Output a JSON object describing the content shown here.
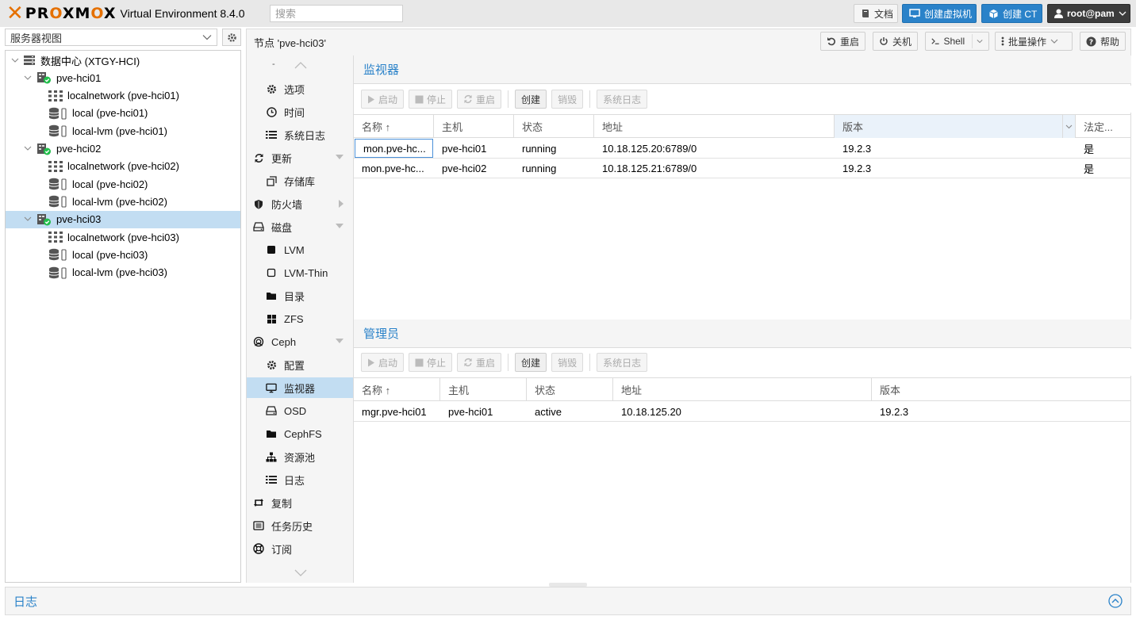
{
  "header": {
    "product_name": "PROXMOX",
    "version": "Virtual Environment 8.4.0",
    "search_placeholder": "搜索",
    "docs_label": "文档",
    "create_vm_label": "创建虚拟机",
    "create_ct_label": "创建 CT",
    "user_label": "root@pam"
  },
  "left": {
    "view_select": "服务器视图",
    "tree": [
      {
        "label": "数据中心 (XTGY-HCI)",
        "type": "datacenter",
        "level": 0
      },
      {
        "label": "pve-hci01",
        "type": "node",
        "level": 1
      },
      {
        "label": "localnetwork (pve-hci01)",
        "type": "network",
        "level": 2
      },
      {
        "label": "local (pve-hci01)",
        "type": "storage",
        "level": 2
      },
      {
        "label": "local-lvm (pve-hci01)",
        "type": "storage",
        "level": 2
      },
      {
        "label": "pve-hci02",
        "type": "node",
        "level": 1
      },
      {
        "label": "localnetwork (pve-hci02)",
        "type": "network",
        "level": 2
      },
      {
        "label": "local (pve-hci02)",
        "type": "storage",
        "level": 2
      },
      {
        "label": "local-lvm (pve-hci02)",
        "type": "storage",
        "level": 2
      },
      {
        "label": "pve-hci03",
        "type": "node",
        "level": 1,
        "selected": true
      },
      {
        "label": "localnetwork (pve-hci03)",
        "type": "network",
        "level": 2
      },
      {
        "label": "local (pve-hci03)",
        "type": "storage",
        "level": 2
      },
      {
        "label": "local-lvm (pve-hci03)",
        "type": "storage",
        "level": 2
      }
    ]
  },
  "node": {
    "title": "节点 'pve-hci03'",
    "reboot_label": "重启",
    "shutdown_label": "关机",
    "shell_label": "Shell",
    "bulk_label": "批量操作",
    "help_label": "帮助"
  },
  "menu": [
    {
      "label": "选项",
      "icon": "gear-icon",
      "indent": true
    },
    {
      "label": "时间",
      "icon": "clock-icon",
      "indent": true
    },
    {
      "label": "系统日志",
      "icon": "list-icon",
      "indent": true
    },
    {
      "label": "更新",
      "icon": "refresh-icon",
      "indent": false,
      "expand": "down"
    },
    {
      "label": "存储库",
      "icon": "repo-icon",
      "indent": true
    },
    {
      "label": "防火墙",
      "icon": "shield-icon",
      "indent": false,
      "expand": "right"
    },
    {
      "label": "磁盘",
      "icon": "disk-icon",
      "indent": false,
      "expand": "down"
    },
    {
      "label": "LVM",
      "icon": "square-icon",
      "indent": true
    },
    {
      "label": "LVM-Thin",
      "icon": "square-outline-icon",
      "indent": true
    },
    {
      "label": "目录",
      "icon": "folder-icon",
      "indent": true
    },
    {
      "label": "ZFS",
      "icon": "grid-icon",
      "indent": true
    },
    {
      "label": "Ceph",
      "icon": "ceph-icon",
      "indent": false,
      "expand": "down"
    },
    {
      "label": "配置",
      "icon": "gear-icon",
      "indent": true
    },
    {
      "label": "监视器",
      "icon": "monitor-icon",
      "indent": true,
      "selected": true
    },
    {
      "label": "OSD",
      "icon": "disk-icon",
      "indent": true
    },
    {
      "label": "CephFS",
      "icon": "folder-icon",
      "indent": true
    },
    {
      "label": "资源池",
      "icon": "sitemap-icon",
      "indent": true
    },
    {
      "label": "日志",
      "icon": "list-icon",
      "indent": true
    },
    {
      "label": "复制",
      "icon": "retweet-icon",
      "indent": false
    },
    {
      "label": "任务历史",
      "icon": "history-icon",
      "indent": false
    },
    {
      "label": "订阅",
      "icon": "lifebuoy-icon",
      "indent": false
    }
  ],
  "monitor": {
    "title": "监视器",
    "toolbar": {
      "start": "启动",
      "stop": "停止",
      "restart": "重启",
      "create": "创建",
      "destroy": "销毁",
      "syslog": "系统日志"
    },
    "columns": [
      "名称 ↑",
      "主机",
      "状态",
      "地址",
      "版本",
      "法定..."
    ],
    "rows": [
      [
        "mon.pve-hc...",
        "pve-hci01",
        "running",
        "10.18.125.20:6789/0",
        "19.2.3",
        "是"
      ],
      [
        "mon.pve-hc...",
        "pve-hci02",
        "running",
        "10.18.125.21:6789/0",
        "19.2.3",
        "是"
      ]
    ]
  },
  "manager": {
    "title": "管理员",
    "toolbar": {
      "start": "启动",
      "stop": "停止",
      "restart": "重启",
      "create": "创建",
      "destroy": "销毁",
      "syslog": "系统日志"
    },
    "columns": [
      "名称 ↑",
      "主机",
      "状态",
      "地址",
      "版本"
    ],
    "rows": [
      [
        "mgr.pve-hci01",
        "pve-hci01",
        "active",
        "10.18.125.20",
        "19.2.3"
      ]
    ]
  },
  "log": {
    "title": "日志"
  }
}
